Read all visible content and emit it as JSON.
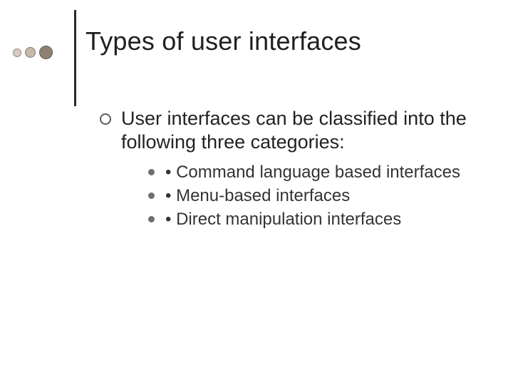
{
  "title": "Types of user interfaces",
  "intro": "User interfaces can be classified into the following three categories:",
  "items": [
    "• Command language based interfaces",
    "• Menu-based interfaces",
    "• Direct manipulation interfaces"
  ]
}
